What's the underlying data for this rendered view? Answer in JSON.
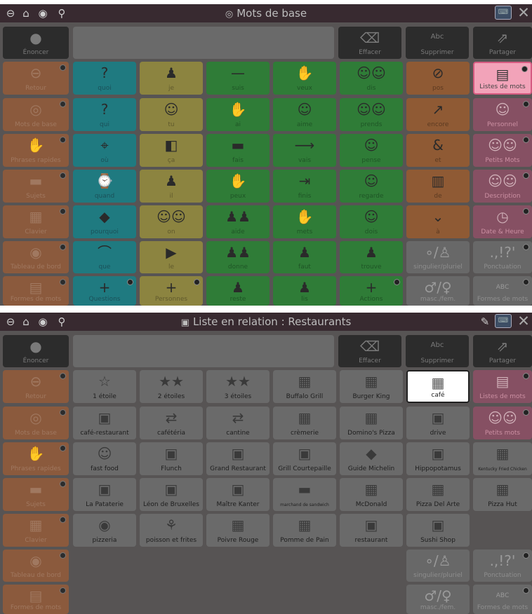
{
  "panel1": {
    "title": "Mots de base",
    "toolbar": {
      "enoncer": "Énoncer",
      "effacer": "Effacer",
      "supprimer": "Supprimer",
      "partager": "Partager",
      "abc": "Abc"
    },
    "side": [
      "Retour",
      "Mots de base",
      "Phrases rapides",
      "Sujets",
      "Clavier",
      "Tableau de bord",
      "Formes de mots"
    ],
    "grid": [
      [
        "quoi",
        "je",
        "suis",
        "veux",
        "dis",
        "pos",
        "Listes de mots"
      ],
      [
        "qui",
        "tu",
        "ai",
        "aime",
        "prends",
        "encore",
        "Personnel"
      ],
      [
        "où",
        "ça",
        "fais",
        "vais",
        "pense",
        "et",
        "Petits Mots"
      ],
      [
        "quand",
        "il",
        "peux",
        "finis",
        "regarde",
        "de",
        "Description"
      ],
      [
        "pourquoi",
        "on",
        "aide",
        "mets",
        "dois",
        "à",
        "Date & Heure"
      ],
      [
        "que",
        "le",
        "donne",
        "faut",
        "trouve",
        "singulier/pluriel",
        "Ponctuation"
      ],
      [
        "Questions",
        "Personnes",
        "reste",
        "lis",
        "Actions",
        "masc./fem.",
        "Formes de mots"
      ]
    ],
    "punct_icon": ".,!?'",
    "gender_icon": "♂/♀",
    "abc_icon": "ABC"
  },
  "panel2": {
    "title": "Liste en relation : Restaurants",
    "toolbar": {
      "enoncer": "Énoncer",
      "effacer": "Effacer",
      "supprimer": "Supprimer",
      "partager": "Partager",
      "abc": "Abc"
    },
    "side": [
      "Retour",
      "Mots de base",
      "Phrases rapides",
      "Sujets",
      "Clavier",
      "Tableau de bord",
      "Formes de mots"
    ],
    "grid": [
      [
        "1 étoile",
        "2 étoiles",
        "3 étoiles",
        "Buffalo Grill",
        "Burger King",
        "café",
        "Listes de mots"
      ],
      [
        "café-restaurant",
        "cafétéria",
        "cantine",
        "crèmerie",
        "Domino's Pizza",
        "drive",
        "Petits mots"
      ],
      [
        "fast food",
        "Flunch",
        "Grand Restaurant",
        "Grill Courtepaille",
        "Guide Michelin",
        "Hippopotamus",
        "Kentucky Fried Chicken"
      ],
      [
        "La Pataterie",
        "Léon de Bruxelles",
        "Maître Kanter",
        "marchand de sandwich",
        "McDonald",
        "Pizza Del Arte",
        "Pizza Hut"
      ],
      [
        "pizzeria",
        "poisson et frites",
        "Poivre Rouge",
        "Pomme de Pain",
        "restaurant",
        "Sushi Shop",
        ""
      ],
      [
        "",
        "",
        "",
        "",
        "",
        "singulier/pluriel",
        "Ponctuation"
      ],
      [
        "",
        "",
        "",
        "",
        "",
        "masc./fem.",
        "Formes de mots"
      ]
    ],
    "punct_icon": ".,!?'",
    "gender_icon": "♂/♀",
    "abc_icon": "ABC"
  },
  "colors": {
    "teal": "#1f7a80",
    "yellow": "#8c8440",
    "green": "#2f7c37",
    "orange": "#8f5a34",
    "pink": "#865063",
    "highlight": "#f2a3b9"
  }
}
